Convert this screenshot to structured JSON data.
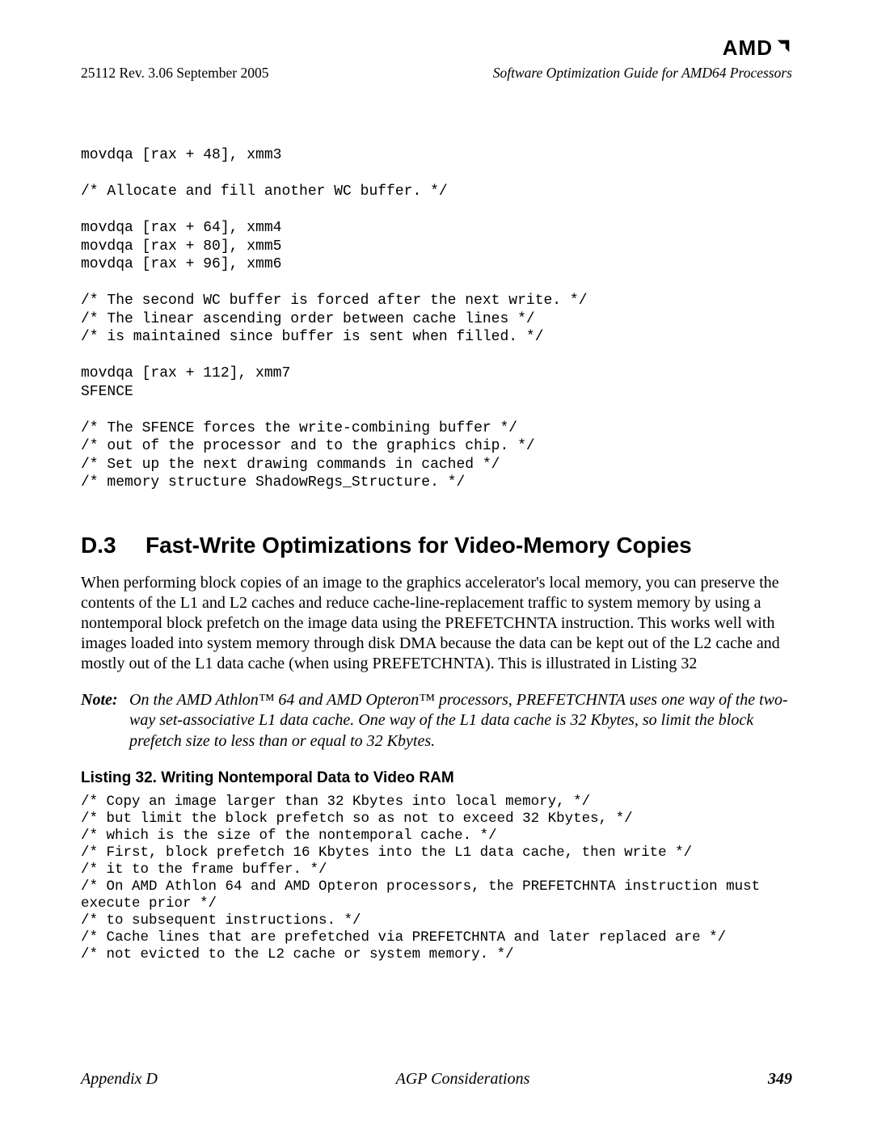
{
  "brand": {
    "name": "AMD"
  },
  "header": {
    "left": "25112   Rev. 3.06   September 2005",
    "right": "Software Optimization Guide for AMD64 Processors"
  },
  "code_block_1": "movdqa [rax + 48], xmm3\n\n/* Allocate and fill another WC buffer. */\n\nmovdqa [rax + 64], xmm4\nmovdqa [rax + 80], xmm5\nmovdqa [rax + 96], xmm6\n\n/* The second WC buffer is forced after the next write. */\n/* The linear ascending order between cache lines */\n/* is maintained since buffer is sent when filled. */\n\nmovdqa [rax + 112], xmm7\nSFENCE\n\n/* The SFENCE forces the write-combining buffer */\n/* out of the processor and to the graphics chip. */\n/* Set up the next drawing commands in cached */\n/* memory structure ShadowRegs_Structure. */",
  "section": {
    "number": "D.3",
    "title": "Fast-Write Optimizations for Video-Memory Copies"
  },
  "paragraph": "When performing block copies of an image to the graphics accelerator's local memory, you can preserve the contents of the L1 and L2 caches and reduce cache-line-replacement traffic to system memory by using a nontemporal block prefetch on the image data using the PREFETCHNTA instruction. This works well with images loaded into system memory through disk DMA because the data can be kept out of the L2 cache and mostly out of the L1 data cache (when using PREFETCHNTA). This is illustrated in Listing 32",
  "note": {
    "label": "Note:",
    "body": "On the AMD Athlon™ 64 and AMD Opteron™ processors, PREFETCHNTA uses one way of the two-way set-associative L1 data cache. One way of the L1 data cache is 32 Kbytes, so limit the block prefetch size to less than or equal to 32 Kbytes."
  },
  "listing": {
    "title": "Listing 32.  Writing Nontemporal Data to Video RAM",
    "code": "/* Copy an image larger than 32 Kbytes into local memory, */\n/* but limit the block prefetch so as not to exceed 32 Kbytes, */\n/* which is the size of the nontemporal cache. */\n/* First, block prefetch 16 Kbytes into the L1 data cache, then write */\n/* it to the frame buffer. */\n/* On AMD Athlon 64 and AMD Opteron processors, the PREFETCHNTA instruction must execute prior */\n/* to subsequent instructions. */\n/* Cache lines that are prefetched via PREFETCHNTA and later replaced are */\n/* not evicted to the L2 cache or system memory. */"
  },
  "footer": {
    "left": "Appendix D",
    "center": "AGP Considerations",
    "page": "349"
  }
}
